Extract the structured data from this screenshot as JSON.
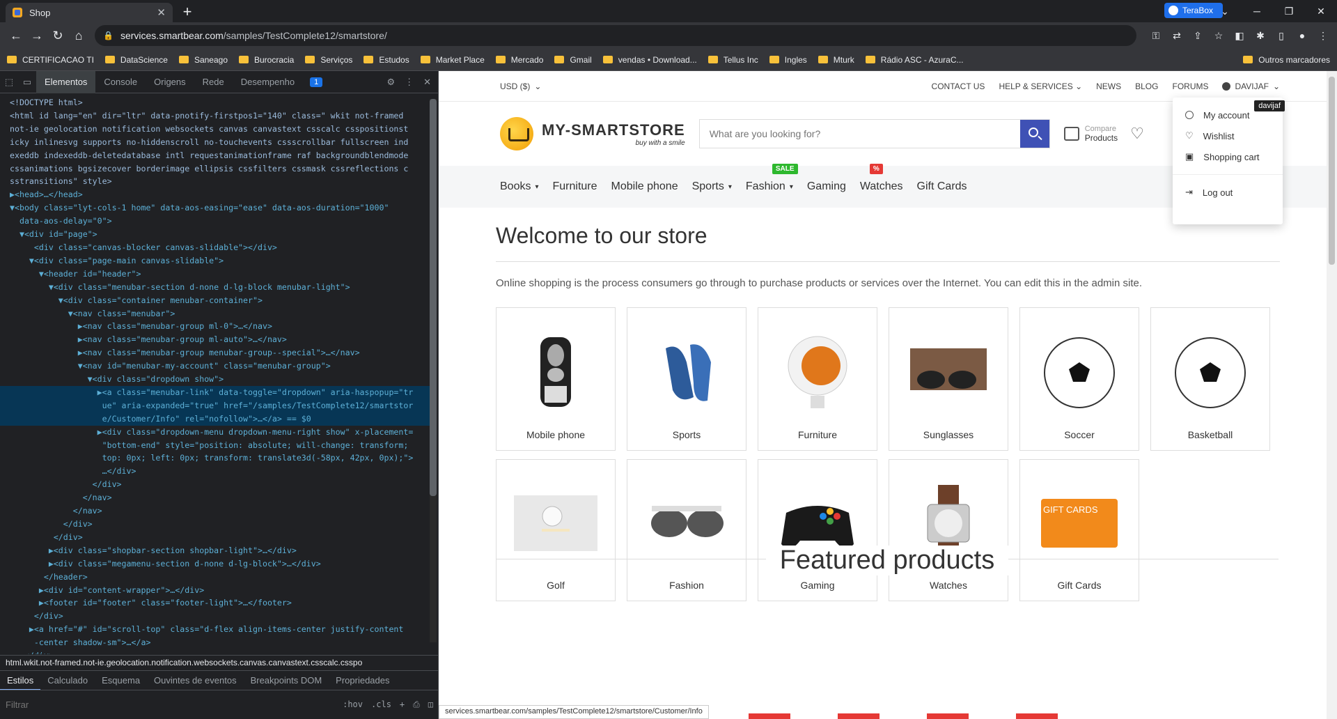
{
  "browser": {
    "tab_title": "Shop",
    "url_host": "services.smartbear.com",
    "url_path": "/samples/TestComplete12/smartstore/",
    "terabox_label": "TeraBox",
    "status_url": "services.smartbear.com/samples/TestComplete12/smartstore/Customer/Info"
  },
  "bookmarks": [
    "CERTIFICACAO TI",
    "DataScience",
    "Saneago",
    "Burocracia",
    "Serviços",
    "Estudos",
    "Market Place",
    "Mercado",
    "Gmail",
    "vendas • Download...",
    "Tellus Inc",
    "Ingles",
    "Mturk",
    "Rádio ASC - AzuraC..."
  ],
  "bookmarks_other": "Outros marcadores",
  "devtools": {
    "tabs": [
      "Elementos",
      "Console",
      "Origens",
      "Rede",
      "Desempenho"
    ],
    "issues_badge": "1",
    "breadcrumb": "html.wkit.not-framed.not-ie.geolocation.notification.websockets.canvas.canvastext.csscalc.csspo",
    "style_tabs": [
      "Estilos",
      "Calculado",
      "Esquema",
      "Ouvintes de eventos",
      "Breakpoints DOM",
      "Propriedades"
    ],
    "filter_placeholder": "Filtrar",
    "hov": ":hov",
    "cls": ".cls",
    "code": [
      "<!DOCTYPE html>",
      "<html id lang=\"en\" dir=\"ltr\" data-pnotify-firstpos1=\"140\" class=\" wkit not-framed",
      "not-ie geolocation notification websockets canvas canvastext csscalc csspositionst",
      "icky inlinesvg supports no-hiddenscroll no-touchevents cssscrollbar fullscreen ind",
      "exeddb indexeddb-deletedatabase intl requestanimationframe raf backgroundblendmode",
      "cssanimations bgsizecover borderimage ellipsis cssfilters cssmask cssreflections c",
      "sstransitions\" style>",
      "▶<head>…</head>",
      "▼<body class=\"lyt-cols-1 home\" data-aos-easing=\"ease\" data-aos-duration=\"1000\"",
      "  data-aos-delay=\"0\">",
      "  ▼<div id=\"page\">",
      "     <div class=\"canvas-blocker canvas-slidable\"></div>",
      "    ▼<div class=\"page-main canvas-slidable\">",
      "      ▼<header id=\"header\">",
      "        ▼<div class=\"menubar-section d-none d-lg-block menubar-light\">",
      "          ▼<div class=\"container menubar-container\">",
      "            ▼<nav class=\"menubar\">",
      "              ▶<nav class=\"menubar-group ml-0\">…</nav>",
      "              ▶<nav class=\"menubar-group ml-auto\">…</nav>",
      "              ▶<nav class=\"menubar-group menubar-group--special\">…</nav>",
      "              ▼<nav id=\"menubar-my-account\" class=\"menubar-group\">",
      "                ▼<div class=\"dropdown show\">",
      "                  ▶<a class=\"menubar-link\" data-toggle=\"dropdown\" aria-haspopup=\"tr",
      "                   ue\" aria-expanded=\"true\" href=\"/samples/TestComplete12/smartstor",
      "                   e/Customer/Info\" rel=\"nofollow\">…</a> == $0",
      "                  ▶<div class=\"dropdown-menu dropdown-menu-right show\" x-placement=",
      "                   \"bottom-end\" style=\"position: absolute; will-change: transform;",
      "                   top: 0px; left: 0px; transform: translate3d(-58px, 42px, 0px);\">",
      "                   …</div>",
      "                 </div>",
      "               </nav>",
      "             </nav>",
      "           </div>",
      "         </div>",
      "        ▶<div class=\"shopbar-section shopbar-light\">…</div>",
      "        ▶<div class=\"megamenu-section d-none d-lg-block\">…</div>",
      "       </header>",
      "      ▶<div id=\"content-wrapper\">…</div>",
      "      ▶<footer id=\"footer\" class=\"footer-light\">…</footer>",
      "     </div>",
      "    ▶<a href=\"#\" id=\"scroll-top\" class=\"d-flex align-items-center justify-content",
      "     -center shadow-sm\">…</a>",
      "   </div>"
    ]
  },
  "store": {
    "currency": "USD  ($)",
    "top_links": [
      "CONTACT US",
      "HELP & SERVICES",
      "NEWS",
      "BLOG",
      "FORUMS"
    ],
    "user": "DAVIJAF",
    "tooltip": "davijaf",
    "logo_main": "MY-SMARTSTORE",
    "logo_tag": "buy with a smile",
    "search_placeholder": "What are you looking for?",
    "compare_small": "Compare",
    "compare_main": "Products",
    "nav": [
      "Books",
      "Furniture",
      "Mobile phone",
      "Sports",
      "Fashion",
      "Gaming",
      "Watches",
      "Gift Cards"
    ],
    "badge_sale": "SALE",
    "badge_pct": "%",
    "welcome_title": "Welcome to our store",
    "welcome_text": "Online shopping is the process consumers go through to purchase products or services over the Internet. You can edit this in the admin site.",
    "categories": [
      "Mobile phone",
      "Sports",
      "Furniture",
      "Sunglasses",
      "Soccer",
      "Basketball",
      "Golf",
      "Fashion",
      "Gaming",
      "Watches",
      "Gift Cards"
    ],
    "giftcard_text": "GIFT CARDS",
    "featured": "Featured products",
    "account_menu": [
      "My account",
      "Wishlist",
      "Shopping cart",
      "Log out"
    ]
  }
}
